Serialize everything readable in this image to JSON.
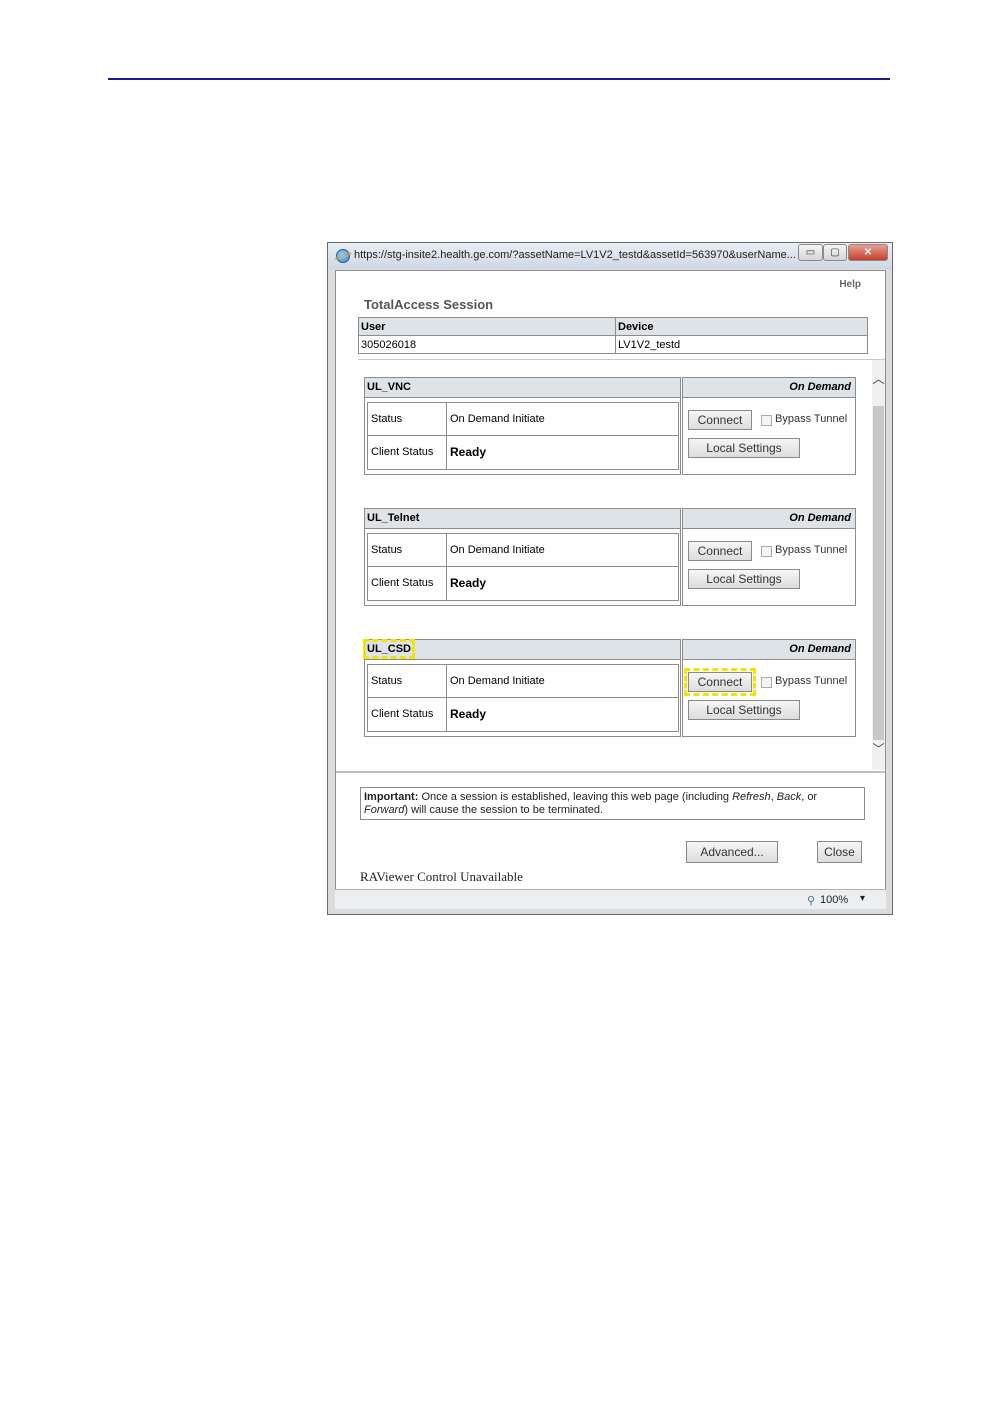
{
  "window": {
    "url": "https://stg-insite2.health.ge.com/?assetName=LV1V2_testd&assetId=563970&userName...",
    "minimize_glyph": "▭",
    "maximize_glyph": "▢",
    "close_glyph": "✕"
  },
  "page": {
    "help": "Help",
    "title": "TotalAccess Session",
    "user_header": "User",
    "device_header": "Device",
    "user_value": "305026018",
    "device_value": "LV1V2_testd"
  },
  "services": [
    {
      "name": "UL_VNC",
      "mode": "On Demand",
      "status_label": "Status",
      "status_value": "On Demand Initiate",
      "client_status_label": "Client Status",
      "client_status_value": "Ready",
      "connect": "Connect",
      "bypass": "Bypass Tunnel",
      "local_settings": "Local Settings"
    },
    {
      "name": "UL_Telnet",
      "mode": "On Demand",
      "status_label": "Status",
      "status_value": "On Demand Initiate",
      "client_status_label": "Client Status",
      "client_status_value": "Ready",
      "connect": "Connect",
      "bypass": "Bypass Tunnel",
      "local_settings": "Local Settings"
    },
    {
      "name": "UL_CSD",
      "mode": "On Demand",
      "status_label": "Status",
      "status_value": "On Demand Initiate",
      "client_status_label": "Client Status",
      "client_status_value": "Ready",
      "connect": "Connect",
      "bypass": "Bypass Tunnel",
      "local_settings": "Local Settings"
    }
  ],
  "important": {
    "label": "Important:",
    "text_a": " Once a session is established, leaving this web page (including ",
    "refresh": "Refresh",
    "comma1": ", ",
    "back": "Back",
    "text_b": ", or ",
    "forward": "Forward",
    "text_c": ") will cause the session to be terminated."
  },
  "buttons": {
    "advanced": "Advanced...",
    "close": "Close"
  },
  "raviewer": "RAViewer Control Unavailable",
  "statusbar": {
    "zoom": "100%",
    "caret": "▾"
  },
  "scroll": {
    "up": "︿",
    "down": "﹀"
  },
  "highlight_color": "#f2e600"
}
